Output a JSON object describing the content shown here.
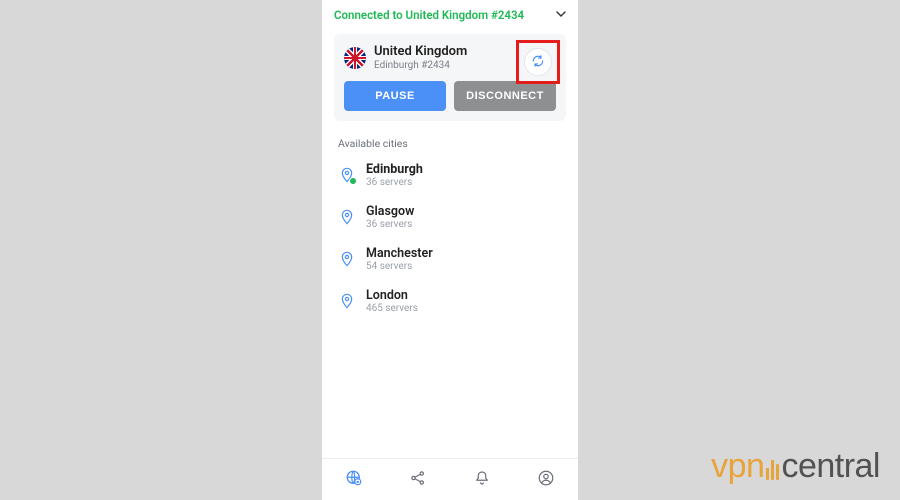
{
  "status": {
    "text": "Connected to United Kingdom #2434"
  },
  "connection": {
    "country": "United Kingdom",
    "server": "Edinburgh #2434",
    "pause_label": "PAUSE",
    "disconnect_label": "DISCONNECT"
  },
  "section_title": "Available cities",
  "cities": [
    {
      "name": "Edinburgh",
      "sub": "36 servers",
      "connected": true
    },
    {
      "name": "Glasgow",
      "sub": "36 servers",
      "connected": false
    },
    {
      "name": "Manchester",
      "sub": "54 servers",
      "connected": false
    },
    {
      "name": "London",
      "sub": "465 servers",
      "connected": false
    }
  ],
  "watermark": {
    "part1": "vpn",
    "part2": "central"
  },
  "colors": {
    "accent_blue": "#4a90f7",
    "connected_green": "#1fb955",
    "highlight_red": "#e51c1c",
    "brand_orange": "#e8a33a"
  }
}
